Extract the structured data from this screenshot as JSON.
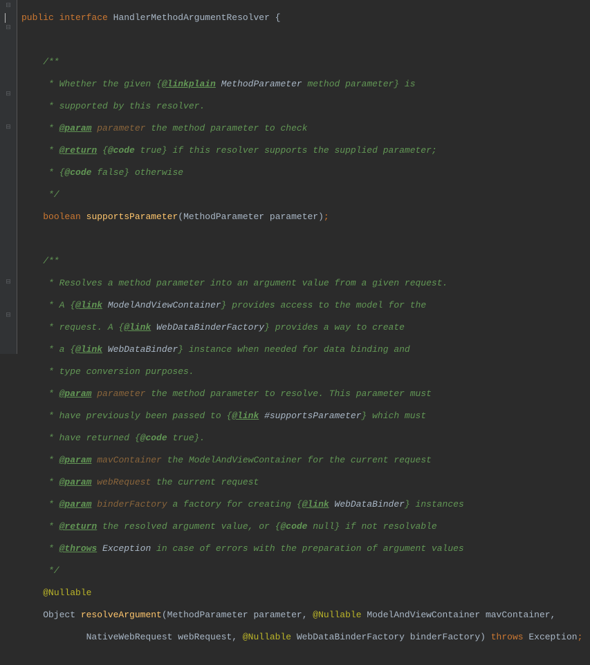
{
  "code": {
    "l1_kw1": "public",
    "l1_kw2": "interface",
    "l1_name": "HandlerMethodArgumentResolver",
    "l1_brace": " {",
    "l2": "",
    "l3": "    /**",
    "l4_a": "     * Whether the given {",
    "l4_tag": "@linkplain",
    "l4_b": " ",
    "l4_ref": "MethodParameter",
    "l4_c": " method parameter} is",
    "l5": "     * supported by this resolver.",
    "l6_a": "     * ",
    "l6_tag": "@param",
    "l6_b": " ",
    "l6_p": "parameter",
    "l6_c": " the method parameter to check",
    "l7_a": "     * ",
    "l7_tag": "@return",
    "l7_b": " {",
    "l7_tag2": "@code",
    "l7_c": " true} if this resolver supports the supplied parameter;",
    "l8_a": "     * {",
    "l8_tag": "@code",
    "l8_b": " false} otherwise",
    "l9": "     */",
    "l10_kw": "boolean",
    "l10_name": "supportsParameter",
    "l10_p1": "(MethodParameter parameter)",
    "l10_semi": ";",
    "l11": "",
    "l12": "    /**",
    "l13": "     * Resolves a method parameter into an argument value from a given request.",
    "l14_a": "     * A {",
    "l14_tag": "@link",
    "l14_b": " ",
    "l14_ref": "ModelAndViewContainer",
    "l14_c": "} provides access to the model for the",
    "l15_a": "     * request. A {",
    "l15_tag": "@link",
    "l15_b": " ",
    "l15_ref": "WebDataBinderFactory",
    "l15_c": "} provides a way to create",
    "l16_a": "     * a {",
    "l16_tag": "@link",
    "l16_b": " ",
    "l16_ref": "WebDataBinder",
    "l16_c": "} instance when needed for data binding and",
    "l17": "     * type conversion purposes.",
    "l18_a": "     * ",
    "l18_tag": "@param",
    "l18_b": " ",
    "l18_p": "parameter",
    "l18_c": " the method parameter to resolve. This parameter must",
    "l19_a": "     * have previously been passed to {",
    "l19_tag": "@link",
    "l19_b": " ",
    "l19_ref": "#supportsParameter",
    "l19_c": "} which must",
    "l20_a": "     * have returned {",
    "l20_tag": "@code",
    "l20_b": " true}.",
    "l21_a": "     * ",
    "l21_tag": "@param",
    "l21_b": " ",
    "l21_p": "mavContainer",
    "l21_c": " the ModelAndViewContainer for the current request",
    "l22_a": "     * ",
    "l22_tag": "@param",
    "l22_b": " ",
    "l22_p": "webRequest",
    "l22_c": " the current request",
    "l23_a": "     * ",
    "l23_tag": "@param",
    "l23_b": " ",
    "l23_p": "binderFactory",
    "l23_c": " a factory for creating {",
    "l23_tag2": "@link",
    "l23_d": " ",
    "l23_ref": "WebDataBinder",
    "l23_e": "} instances",
    "l24_a": "     * ",
    "l24_tag": "@return",
    "l24_b": " the resolved argument value, or {",
    "l24_tag2": "@code",
    "l24_c": " null} if not resolvable",
    "l25_a": "     * ",
    "l25_tag": "@throws",
    "l25_b": " ",
    "l25_ref": "Exception",
    "l25_c": " in case of errors with the preparation of argument values",
    "l26": "     */",
    "l27_ann": "@Nullable",
    "l28_a": "    Object ",
    "l28_name": "resolveArgument",
    "l28_b": "(MethodParameter parameter, ",
    "l28_ann": "@Nullable",
    "l28_c": " ModelAndViewContainer mavContainer,",
    "l29_a": "            NativeWebRequest webRequest, ",
    "l29_ann": "@Nullable",
    "l29_b": " WebDataBinderFactory binderFactory) ",
    "l29_kw": "throws",
    "l29_c": " Exception",
    "l29_semi": ";"
  }
}
